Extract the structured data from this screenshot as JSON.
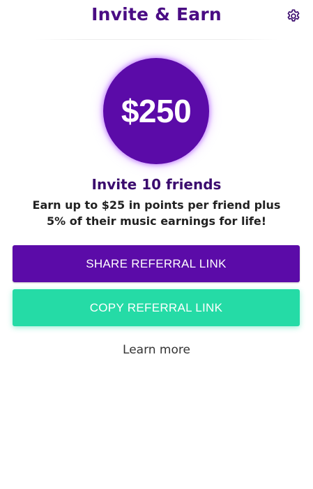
{
  "header": {
    "title": "Invite & Earn",
    "settings_icon": "gear-icon"
  },
  "reward": {
    "amount": "$250"
  },
  "offer": {
    "headline": "Invite 10 friends",
    "description_line1": "Earn up to $25 in points per friend plus",
    "description_line2": "5% of their music earnings for life!"
  },
  "actions": {
    "share_label": "SHARE REFERRAL LINK",
    "copy_label": "COPY REFERRAL LINK",
    "learn_more_label": "Learn more"
  },
  "colors": {
    "brand_purple": "#5b0ba8",
    "title_purple": "#4a0c84",
    "accent_green": "#25dba6"
  }
}
